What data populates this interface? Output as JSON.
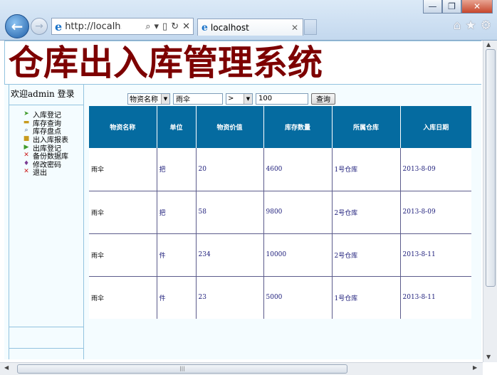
{
  "browser": {
    "address": "http://localh...",
    "tab_title": "localhost",
    "window_buttons": {
      "minimize": "—",
      "maximize": "❐",
      "close": "✕"
    }
  },
  "banner": {
    "title": "仓库出入库管理系统"
  },
  "sidebar": {
    "welcome": "欢迎admin 登录",
    "items": [
      {
        "label": "入库登记",
        "icon": "arrow-check-icon"
      },
      {
        "label": "库存查询",
        "icon": "folder-icon"
      },
      {
        "label": "库存盘点",
        "icon": "magnifier-icon"
      },
      {
        "label": "出入库报表",
        "icon": "folder-open-icon"
      },
      {
        "label": "出库登记",
        "icon": "arrow-out-icon"
      },
      {
        "label": "备份数据库",
        "icon": "red-x-icon"
      },
      {
        "label": "修改密码",
        "icon": "pin-icon"
      },
      {
        "label": "退出",
        "icon": "red-x-icon"
      }
    ]
  },
  "filter": {
    "field_select": "物资名称",
    "keyword": "雨伞",
    "operator_select": ">",
    "number": "100",
    "search_label": "查询"
  },
  "table": {
    "columns": [
      "物资名称",
      "单位",
      "物资价值",
      "库存数量",
      "所属仓库",
      "入库日期"
    ],
    "rows": [
      [
        "雨伞",
        "把",
        "20",
        "4600",
        "1号仓库",
        "2013-8-09"
      ],
      [
        "雨伞",
        "把",
        "58",
        "9800",
        "2号仓库",
        "2013-8-09"
      ],
      [
        "雨伞",
        "件",
        "234",
        "10000",
        "2号仓库",
        "2013-8-11"
      ],
      [
        "雨伞",
        "件",
        "23",
        "5000",
        "1号仓库",
        "2013-8-11"
      ]
    ]
  },
  "colors": {
    "header_bg": "#056ba0",
    "title": "#7d0000",
    "page_bg": "#f4fcff"
  }
}
